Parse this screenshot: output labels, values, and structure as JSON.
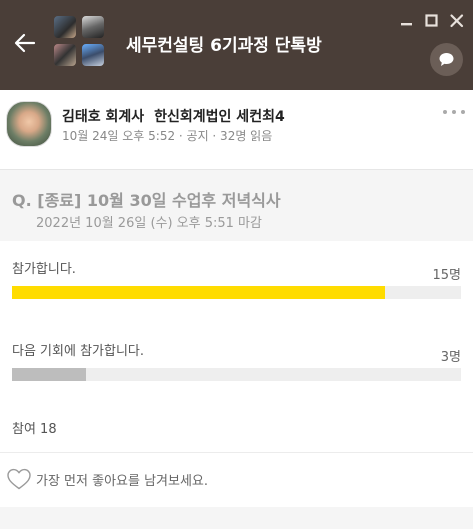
{
  "window": {
    "title": "세무컨설팅 6기과정 단톡방"
  },
  "post": {
    "author": "김태호 회계사",
    "organization": "한신회계법인 세컨최4",
    "meta": "10월 24일 오후 5:52 · 공지 · 32명 읽음"
  },
  "poll": {
    "question": "Q. [종료] 10월 30일 수업후 저녁식사",
    "deadline": "2022년 10월 26일 (수) 오후 5:51 마감",
    "options": [
      {
        "label": "참가합니다.",
        "count": "15명",
        "fraction": 0.83,
        "color": "#ffdc00"
      },
      {
        "label": "다음 기회에 참가합니다.",
        "count": "3명",
        "fraction": 0.165,
        "color": "#bdbdbd"
      }
    ],
    "participants": "참여 18"
  },
  "like": {
    "prompt": "가장 먼저 좋아요를 남겨보세요."
  },
  "colors": {
    "titlebar": "#4a3e38",
    "accent": "#ffdc00"
  },
  "icons": [
    "back-arrow-icon",
    "minimize-icon",
    "maximize-icon",
    "close-icon",
    "chat-bubble-icon",
    "more-icon",
    "heart-icon"
  ]
}
